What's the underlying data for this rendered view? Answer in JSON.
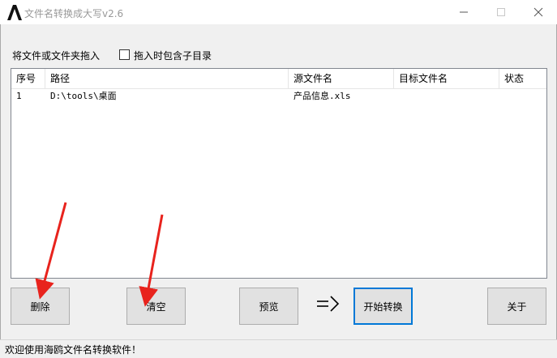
{
  "window": {
    "title": "文件名转换成大写v2.6"
  },
  "drop_area": {
    "label": "将文件或文件夹拖入",
    "checkbox_label": "拖入时包含子目录",
    "checkbox_checked": false
  },
  "table": {
    "columns": [
      "序号",
      "路径",
      "源文件名",
      "目标文件名",
      "状态"
    ],
    "rows": [
      {
        "index": "1",
        "path": "D:\\tools\\桌面",
        "source": "产品信息.xls",
        "target": "",
        "status": ""
      }
    ]
  },
  "buttons": {
    "delete": "删除",
    "clear": "清空",
    "preview": "预览",
    "arrow": "=>",
    "start": "开始转换",
    "about": "关于"
  },
  "status_bar": {
    "text": "欢迎使用海鸥文件名转换软件！"
  },
  "colors": {
    "accent": "#0078d7",
    "annotation_arrow": "#e8231d"
  }
}
